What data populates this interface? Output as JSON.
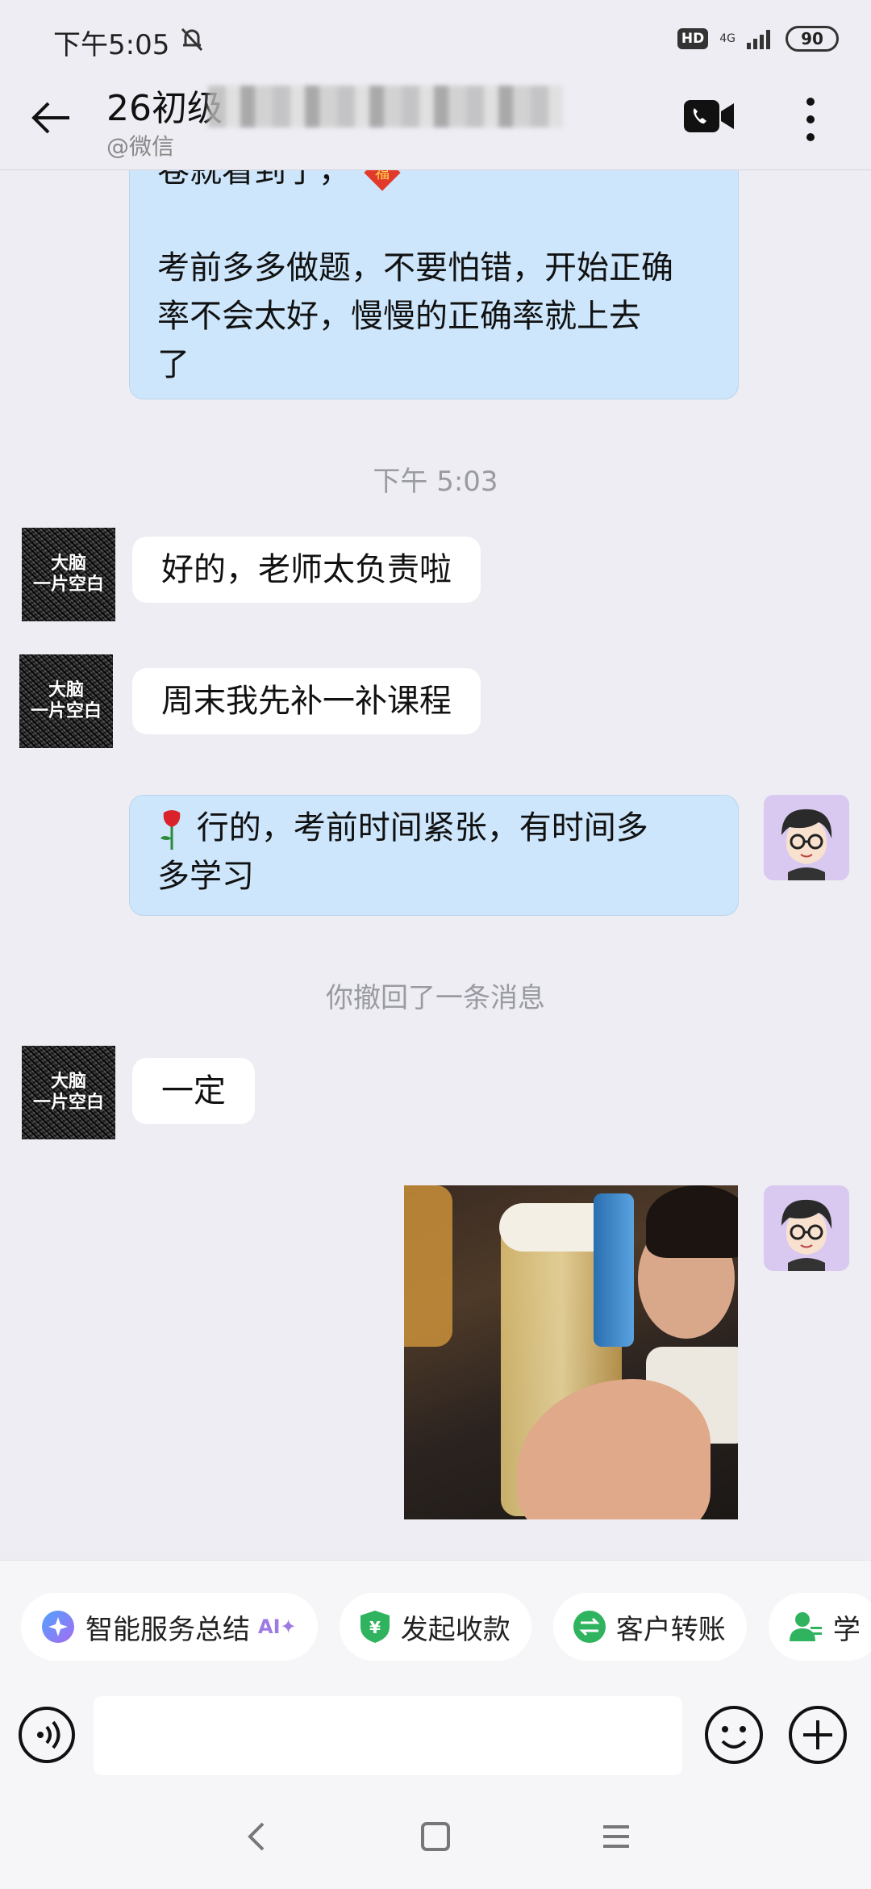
{
  "status_bar": {
    "time": "下午5:05",
    "hd": "HD",
    "network": "4G",
    "battery": "90"
  },
  "header": {
    "title": "26初级",
    "subtitle": "@微信"
  },
  "messages": {
    "out1_line1": "卷就看到了，",
    "out1_line2": "考前多多做题，不要怕错，开始正确",
    "out1_line3": "率不会太好，慢慢的正确率就上去",
    "out1_line4": "了",
    "time1": "下午 5:03",
    "in1": "好的，老师太负责啦",
    "in2": "周末我先补一补课程",
    "out2_line1": "行的，考前时间紧张，有时间多",
    "out2_line2": "多学习",
    "recall": "你撤回了一条消息",
    "in3": "一定",
    "avatar_text": "大脑\n一片空白"
  },
  "chips": [
    {
      "label": "智能服务总结",
      "badge": "AI✦",
      "icon": "ai-sparkle-icon"
    },
    {
      "label": "发起收款",
      "icon": "shield-yuan-icon"
    },
    {
      "label": "客户转账",
      "icon": "transfer-icon"
    },
    {
      "label": "学",
      "icon": "user-student-icon"
    }
  ],
  "colors": {
    "out_bubble": "#cde6fb",
    "in_bubble": "#ffffff",
    "background": "#ededf3",
    "green": "#2fb35f"
  }
}
